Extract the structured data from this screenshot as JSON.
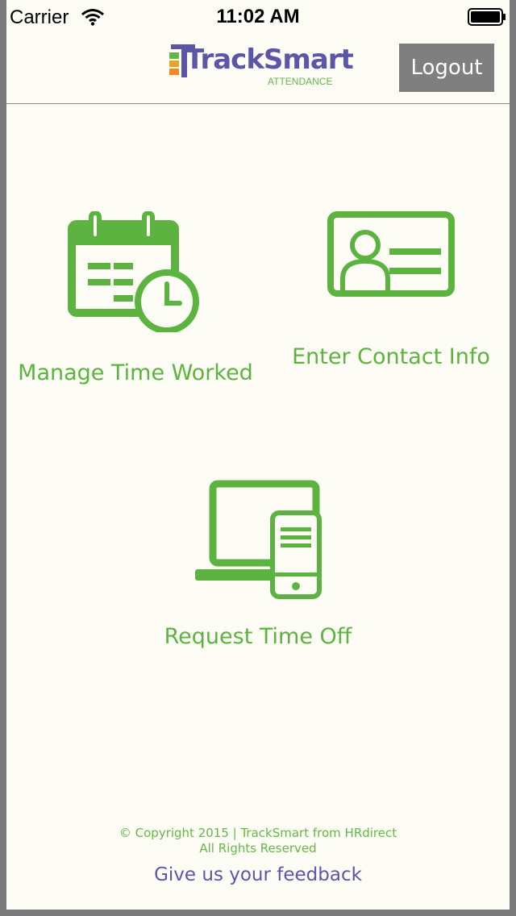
{
  "status_bar": {
    "carrier": "Carrier",
    "time": "11:02 AM"
  },
  "header": {
    "logo_text": "TrackSmart",
    "logo_subtext": "ATTENDANCE",
    "logout_label": "Logout"
  },
  "tiles": [
    {
      "label": "Manage Time Worked",
      "icon": "calendar-clock-icon"
    },
    {
      "label": "Enter Contact Info",
      "icon": "contact-card-icon"
    },
    {
      "label": "Request Time Off",
      "icon": "desktop-phone-icon"
    }
  ],
  "footer": {
    "copyright_line1": "© Copyright 2015 | TrackSmart from HRdirect",
    "copyright_line2": "All Rights Reserved",
    "feedback_label": "Give us your feedback"
  },
  "colors": {
    "accent_green": "#5cb33f",
    "brand_purple": "#5b56a8",
    "logout_gray": "#7f7f7f"
  }
}
